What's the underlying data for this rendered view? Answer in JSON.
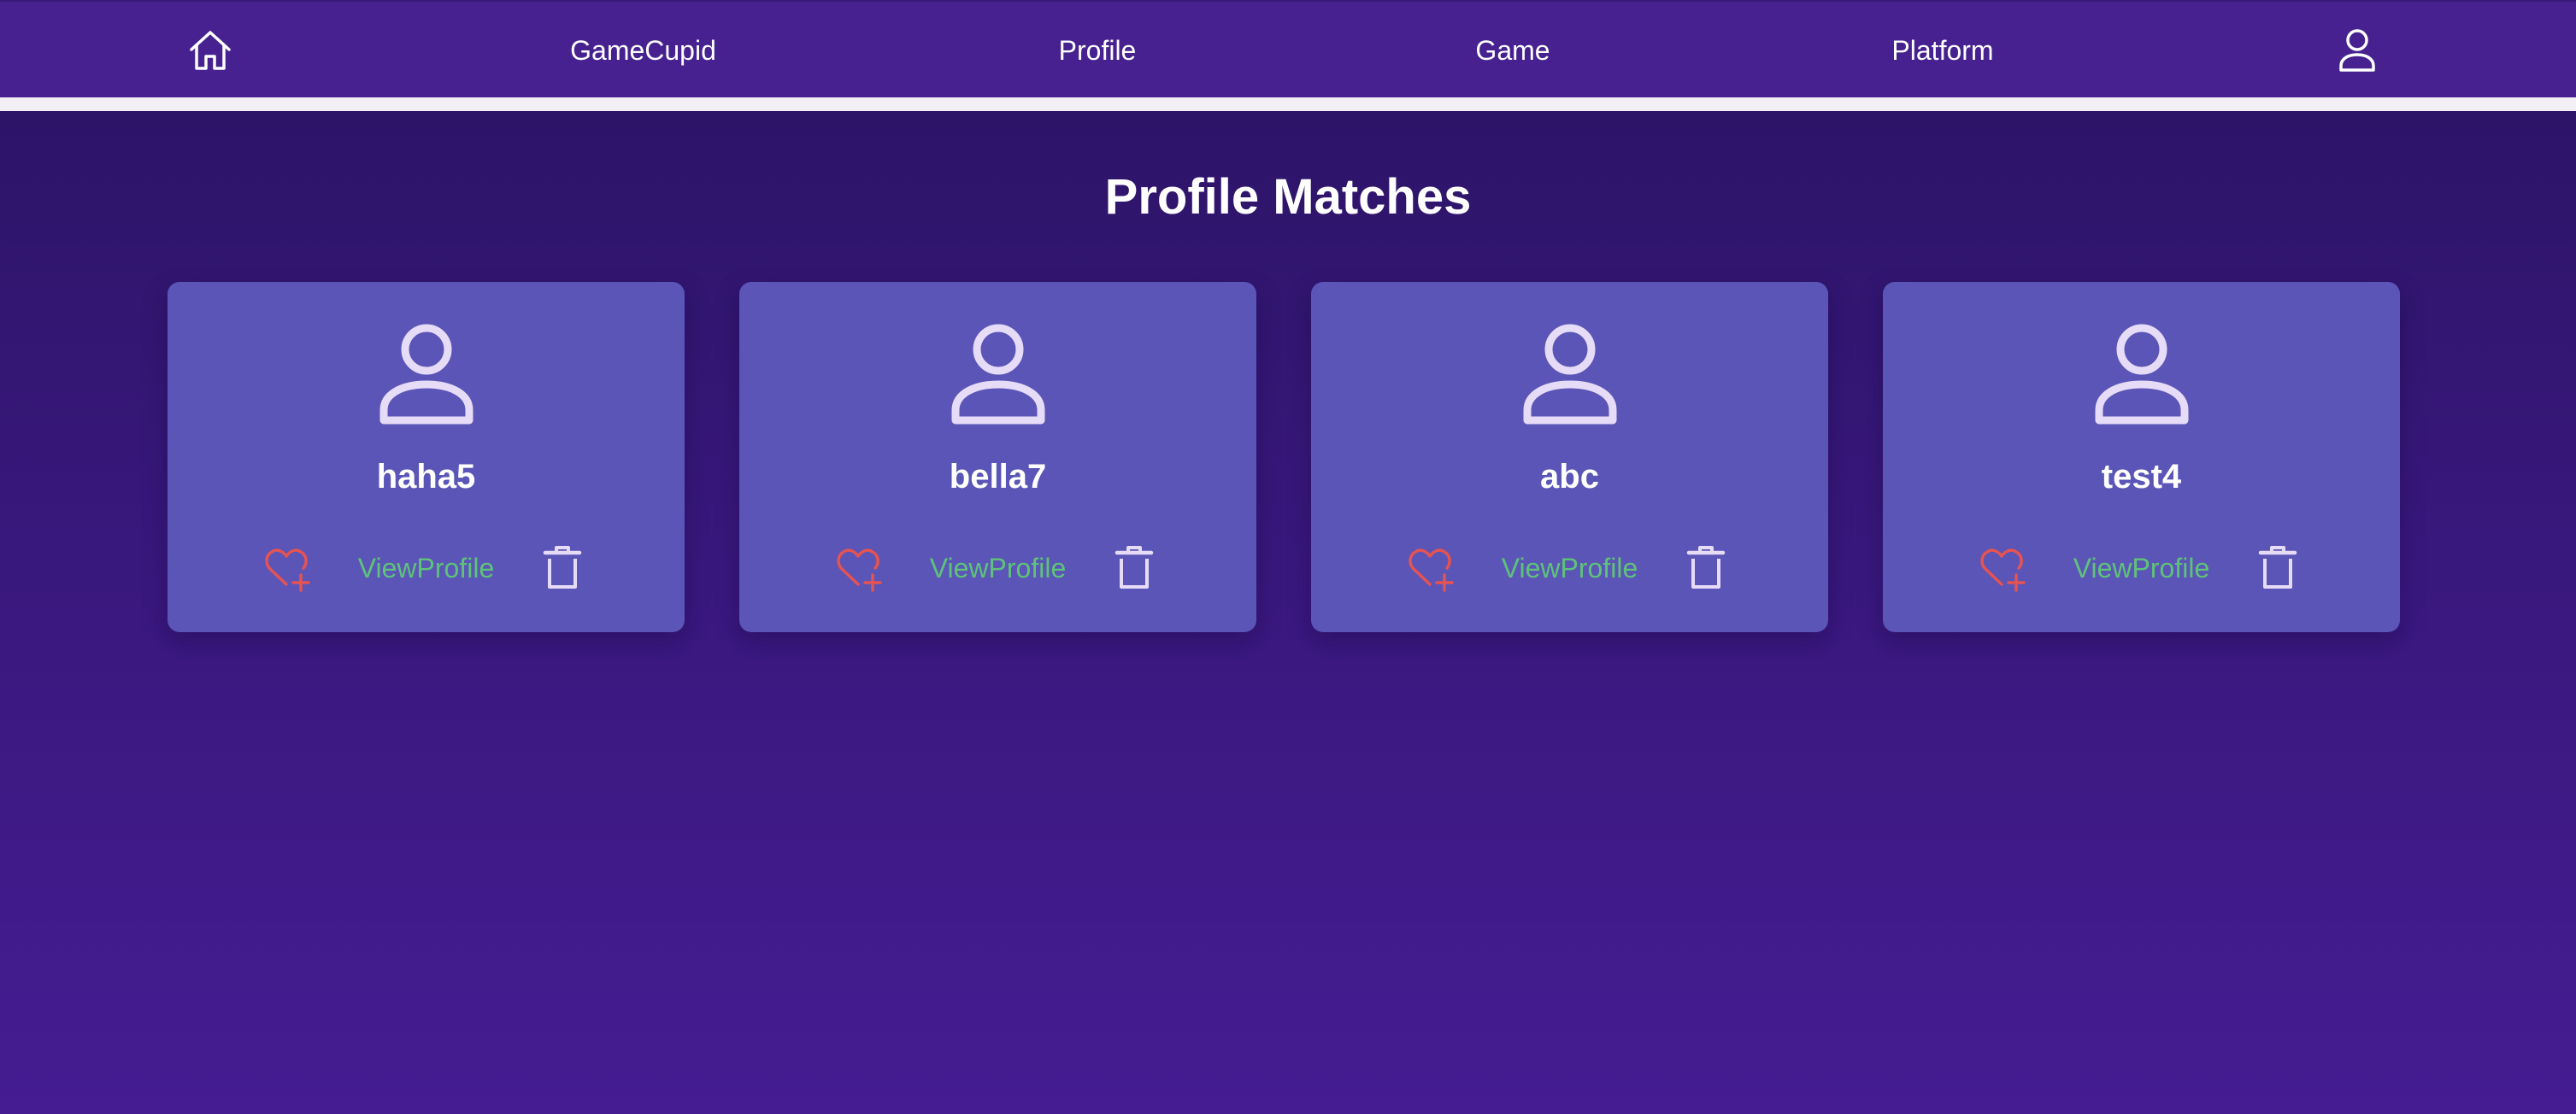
{
  "nav": {
    "home_icon": "home-icon",
    "brand": "GameCupid",
    "profile": "Profile",
    "game": "Game",
    "platform": "Platform",
    "user_icon": "user-icon"
  },
  "page_title": "Profile Matches",
  "cards": [
    {
      "name": "haha5",
      "view_label": "ViewProfile"
    },
    {
      "name": "bella7",
      "view_label": "ViewProfile"
    },
    {
      "name": "abc",
      "view_label": "ViewProfile"
    },
    {
      "name": "test4",
      "view_label": "ViewProfile"
    }
  ],
  "colors": {
    "nav_bg": "#46218f",
    "card_bg": "#5a55b6",
    "like_icon": "#e55353",
    "view_link": "#5ec37a",
    "avatar_icon": "#e7dcf7",
    "delete_icon": "#e7dcf7"
  }
}
